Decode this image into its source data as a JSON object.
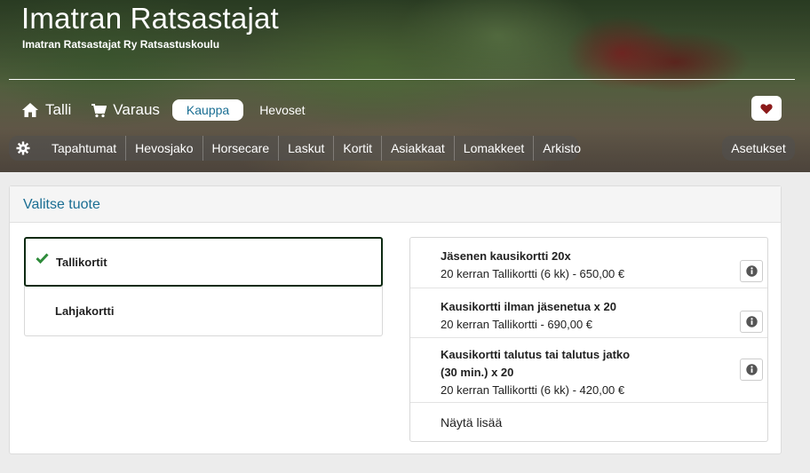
{
  "header": {
    "title": "Imatran Ratsastajat",
    "subtitle": "Imatran Ratsastajat Ry Ratsastuskoulu"
  },
  "main_nav": {
    "talli": "Talli",
    "varaus": "Varaus",
    "kauppa": "Kauppa",
    "hevoset": "Hevoset"
  },
  "sub_nav": {
    "items": [
      "Tapahtumat",
      "Hevosjako",
      "Horsecare",
      "Laskut",
      "Kortit",
      "Asiakkaat",
      "Lomakkeet",
      "Arkisto"
    ],
    "settings": "Asetukset"
  },
  "panel": {
    "title": "Valitse tuote",
    "categories": [
      {
        "label": "Tallikortit",
        "selected": true
      },
      {
        "label": "Lahjakortti",
        "selected": false
      }
    ],
    "products": [
      {
        "name_line1": "Jäsenen kausikortti 20x",
        "name_line2": "",
        "detail": "20 kerran Tallikortti (6 kk) - 650,00 €"
      },
      {
        "name_line1": "Kausikortti ilman jäsenetua x 20",
        "name_line2": "",
        "detail": "20 kerran Tallikortti - 690,00 €"
      },
      {
        "name_line1": "Kausikortti talutus tai talutus jatko",
        "name_line2": "(30 min.) x 20",
        "detail": "20 kerran Tallikortti (6 kk) - 420,00 €"
      }
    ],
    "show_more": "Näytä lisää"
  },
  "colors": {
    "accent": "#1a6e93",
    "check": "#2e8b3a",
    "heart": "#8b1a1a"
  },
  "icons": {
    "talli": "home-icon",
    "varaus": "cart-icon",
    "favorite": "heart-icon",
    "settings": "gear-icon",
    "selected": "check-icon",
    "product_info": "info-icon"
  }
}
